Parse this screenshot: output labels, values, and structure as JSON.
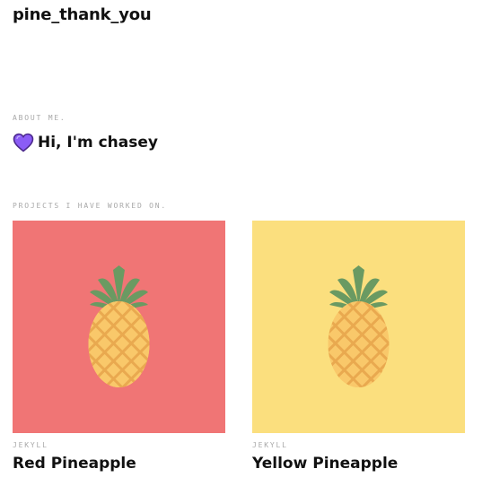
{
  "site": {
    "title": "pine_thank_you"
  },
  "about": {
    "label": "ABOUT ME.",
    "icon": "purple-heart-icon",
    "intro": "Hi, I'm chasey"
  },
  "projects": {
    "label": "PROJECTS I HAVE WORKED ON.",
    "items": [
      {
        "tag": "JEKYLL",
        "title": "Red Pineapple",
        "background": "#f07575",
        "icon": "pineapple-icon"
      },
      {
        "tag": "JEKYLL",
        "title": "Yellow Pineapple",
        "background": "#fbdf7e",
        "icon": "pineapple-icon"
      }
    ]
  },
  "colors": {
    "heart": "#8b5cf6",
    "pineapple_body": "#f9c86a",
    "pineapple_pattern": "#e9a94f",
    "pineapple_leaves": "#6a9a62"
  }
}
